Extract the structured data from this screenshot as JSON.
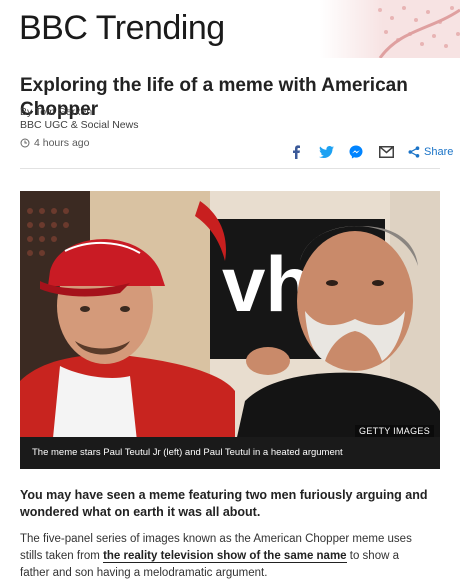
{
  "header": {
    "brand": "BBC Trending"
  },
  "article": {
    "headline": "Exploring the life of a meme with American Chopper",
    "author": "By Tom Gerken",
    "department": "BBC UGC & Social News",
    "timestamp": "4 hours ago"
  },
  "share": {
    "icons": [
      "facebook-icon",
      "twitter-icon",
      "messenger-icon",
      "email-icon"
    ],
    "label": "Share",
    "brand_colors": {
      "facebook": "#3b5998",
      "twitter": "#1da1f2",
      "messenger": "#0084ff",
      "share": "#1a73c7"
    }
  },
  "image": {
    "credit": "GETTY IMAGES",
    "caption": "The meme stars Paul Teutul Jr (left) and Paul Teutul in a heated argument"
  },
  "body": {
    "lede": "You may have seen a meme featuring two men furiously arguing and wondered what on earth it was all about.",
    "paragraph_before": "The five-panel series of images known as the American Chopper meme uses stills taken from ",
    "paragraph_link": "the reality television show of the same name",
    "paragraph_after": " to show a father and son having a melodramatic argument."
  }
}
